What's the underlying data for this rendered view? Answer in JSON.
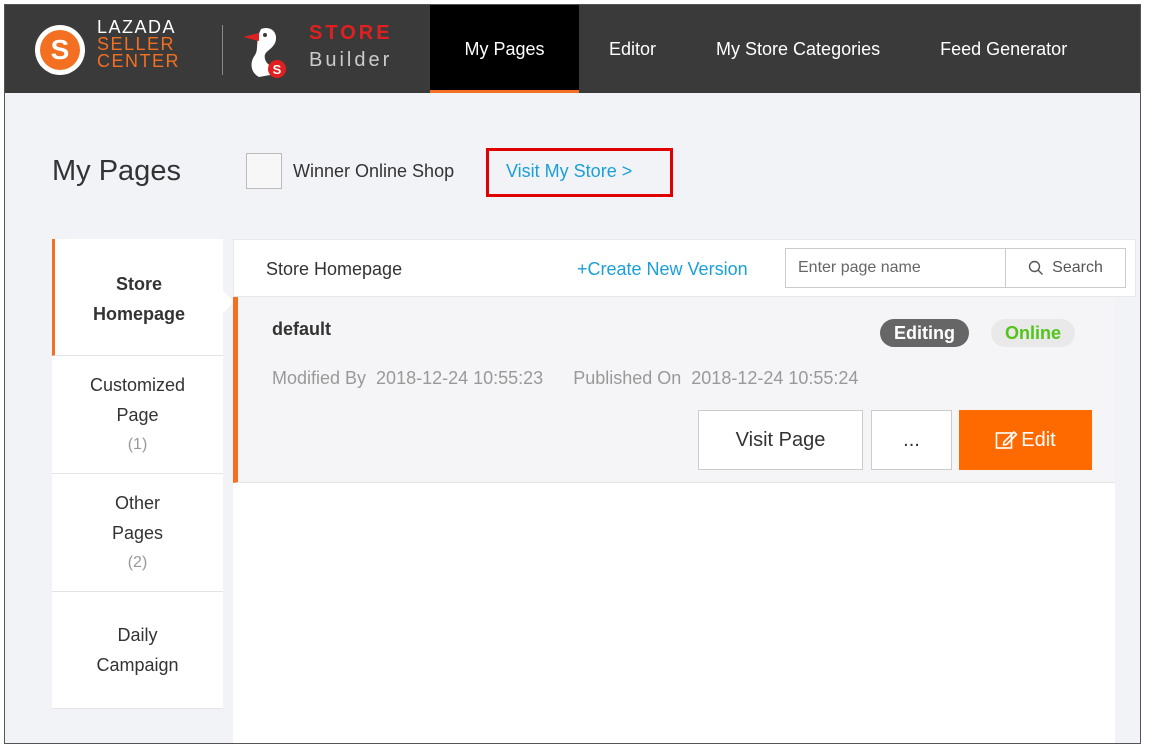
{
  "app": {
    "lazada_logo": [
      "LAZADA",
      "SELLER",
      "CENTER"
    ],
    "store_builder_logo": [
      "STORE",
      "Builder"
    ],
    "accent_color": "#f36f21"
  },
  "nav": {
    "items": [
      {
        "label": "My Pages",
        "active": true
      },
      {
        "label": "Editor",
        "active": false
      },
      {
        "label": "My Store Categories",
        "active": false
      },
      {
        "label": "Feed Generator",
        "active": false
      }
    ]
  },
  "header": {
    "title": "My Pages",
    "shop_name": "Winner Online Shop",
    "visit_store_link": "Visit My Store >"
  },
  "sidebar": {
    "items": [
      {
        "line1": "Store",
        "line2": "Homepage",
        "count": "",
        "active": true
      },
      {
        "line1": "Customized",
        "line2": "Page",
        "count": "(1)",
        "active": false
      },
      {
        "line1": "Other",
        "line2": "Pages",
        "count": "(2)",
        "active": false
      },
      {
        "line1": "Daily",
        "line2": "Campaign",
        "count": "",
        "active": false
      }
    ]
  },
  "main": {
    "section_title": "Store Homepage",
    "create_link": "+Create New Version",
    "search_placeholder": "Enter page name",
    "search_label": "Search",
    "page": {
      "name": "default",
      "status_editing": "Editing",
      "status_online": "Online",
      "modified_label": "Modified By",
      "modified_value": "2018-12-24 10:55:23",
      "published_label": "Published On",
      "published_value": "2018-12-24 10:55:24",
      "visit_button": "Visit Page",
      "more_button": "...",
      "edit_button": "Edit"
    }
  }
}
